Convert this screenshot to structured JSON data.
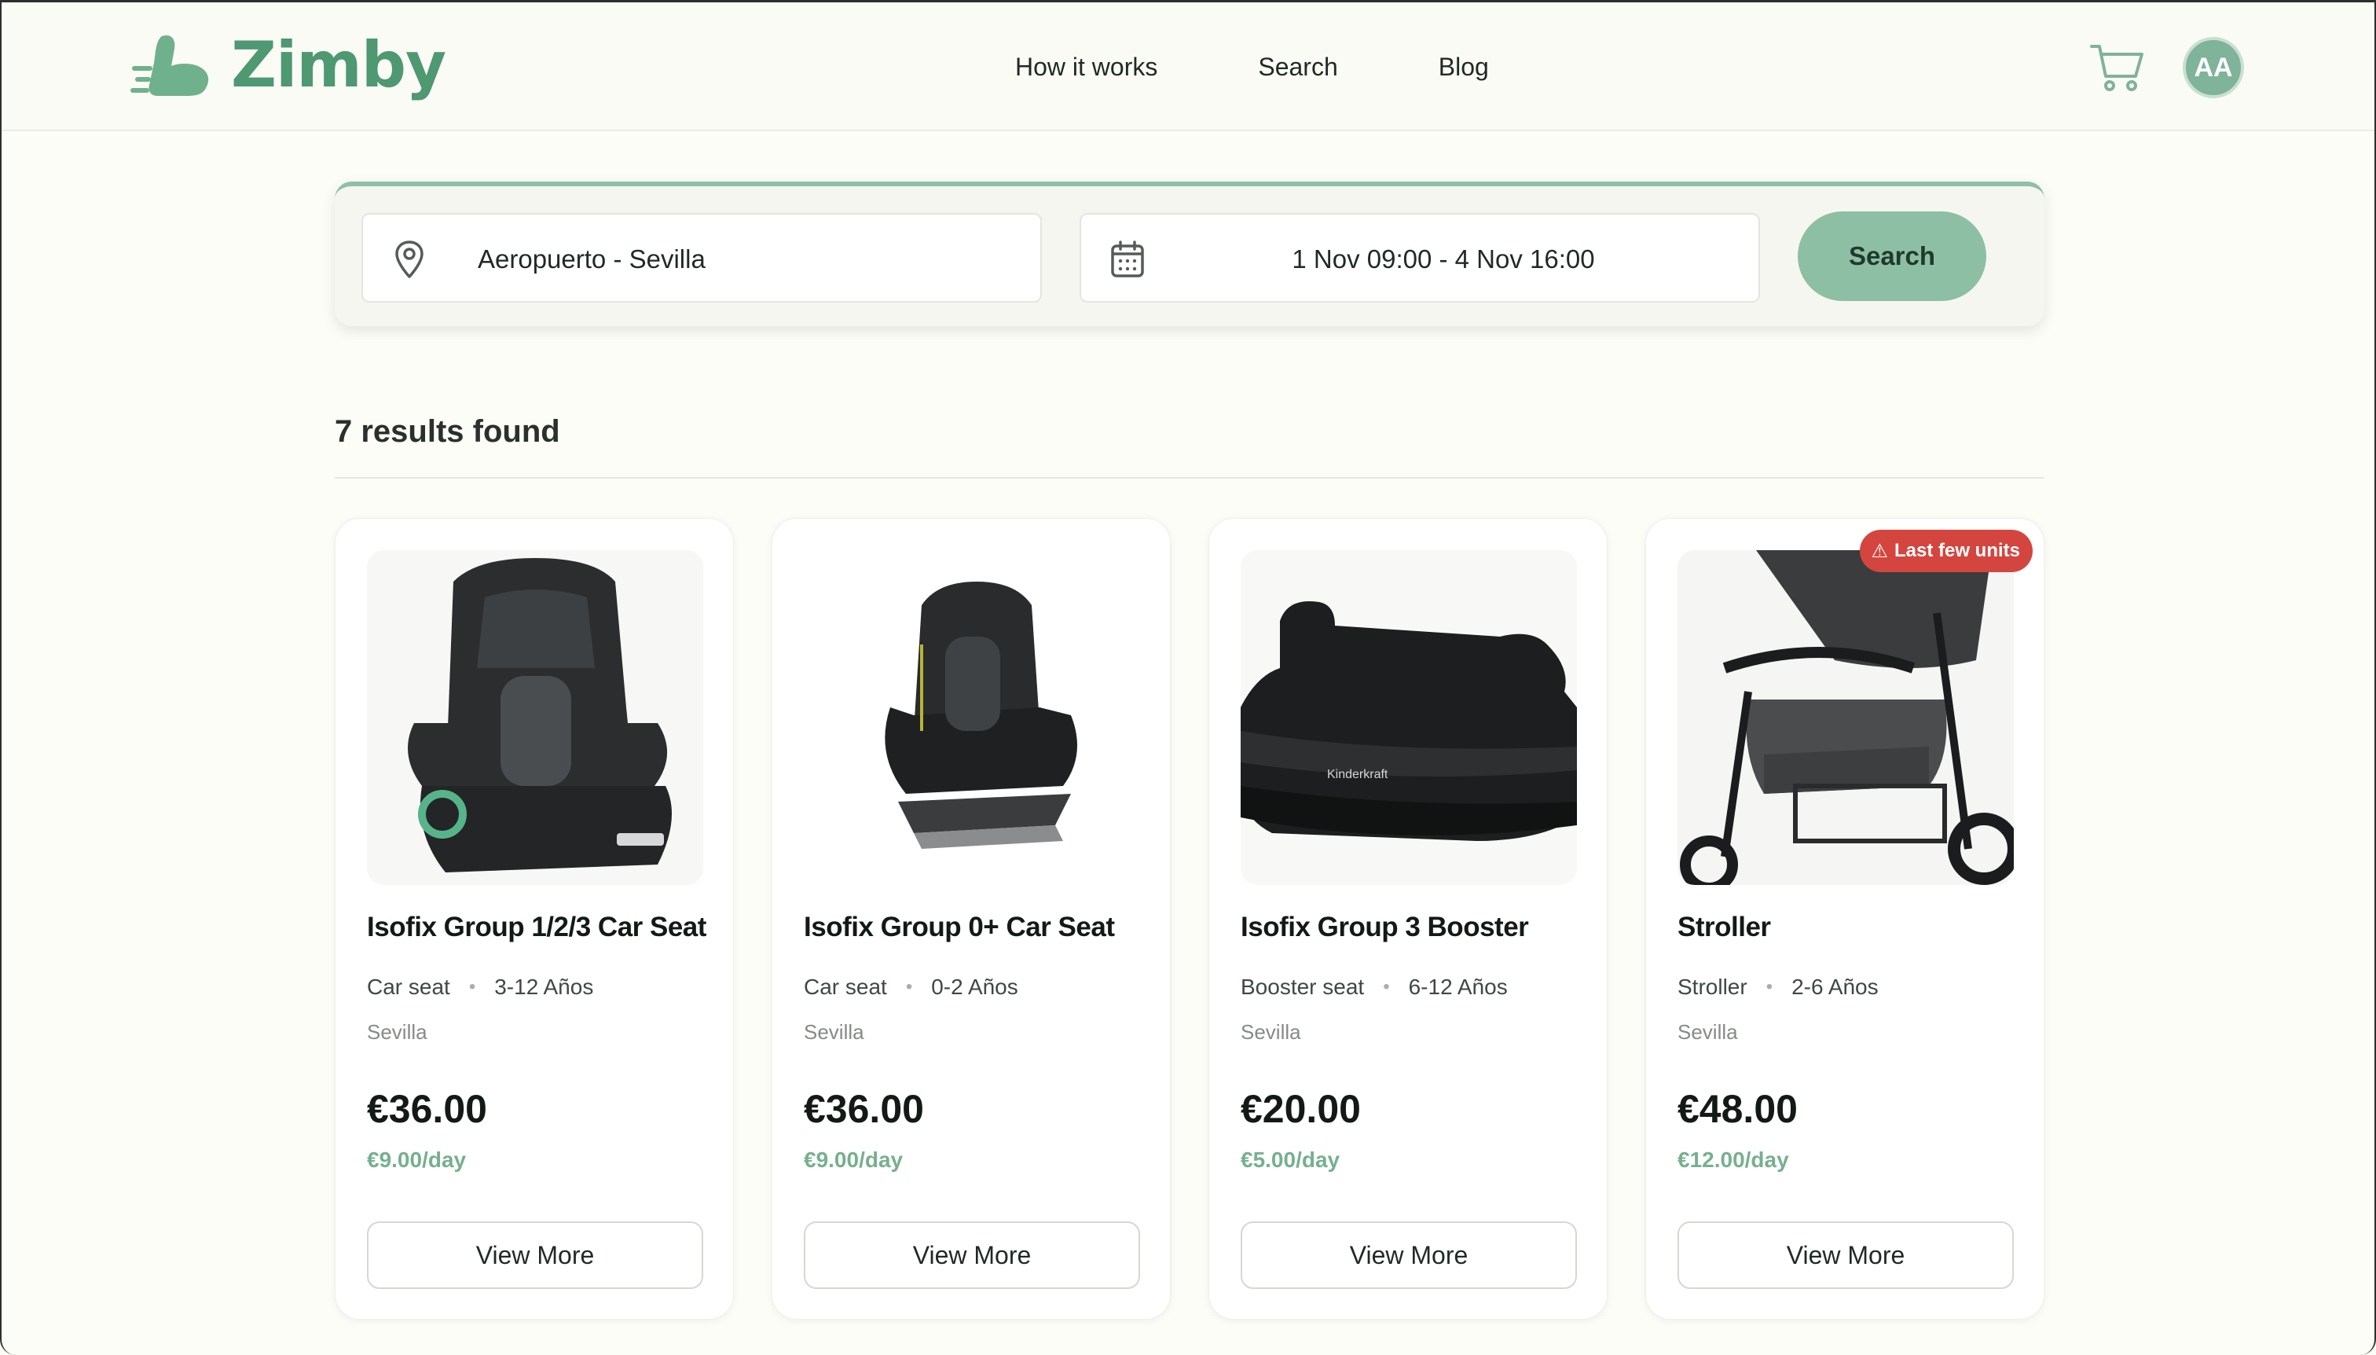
{
  "brand": {
    "name": "Zimby",
    "color": "#4e9872"
  },
  "nav": [
    {
      "label": "How it works"
    },
    {
      "label": "Search"
    },
    {
      "label": "Blog"
    }
  ],
  "user": {
    "initials": "AA"
  },
  "search": {
    "location": "Aeropuerto - Sevilla",
    "dates": "1 Nov 09:00 - 4 Nov 16:00",
    "button_label": "Search"
  },
  "results": {
    "title": "7 results found"
  },
  "products": [
    {
      "name": "Isofix Group 1/2/3 Car Seat",
      "category": "Car seat",
      "age": "3-12 Años",
      "location": "Sevilla",
      "price": "€36.00",
      "per_day": "€9.00/day",
      "button": "View More"
    },
    {
      "name": "Isofix Group 0+ Car Seat",
      "category": "Car seat",
      "age": "0-2 Años",
      "location": "Sevilla",
      "price": "€36.00",
      "per_day": "€9.00/day",
      "button": "View More"
    },
    {
      "name": "Isofix Group 3 Booster",
      "category": "Booster seat",
      "age": "6-12 Años",
      "location": "Sevilla",
      "price": "€20.00",
      "per_day": "€5.00/day",
      "button": "View More"
    },
    {
      "name": "Stroller",
      "category": "Stroller",
      "age": "2-6 Años",
      "location": "Sevilla",
      "price": "€48.00",
      "per_day": "€12.00/day",
      "button": "View More",
      "badge": "Last few units"
    }
  ]
}
